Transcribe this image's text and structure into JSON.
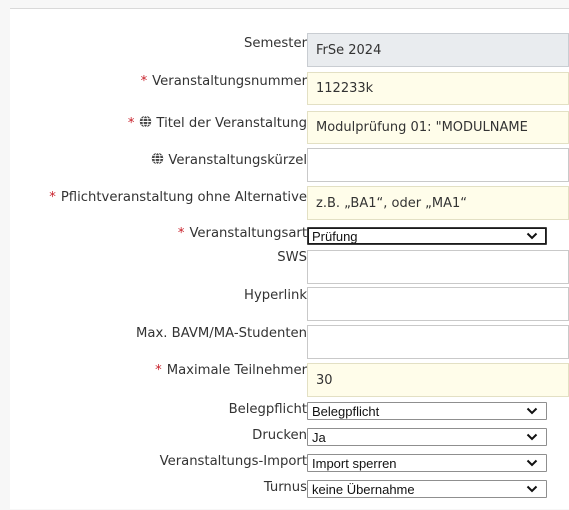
{
  "form": {
    "semester": {
      "label": "Semester",
      "value": "FrSe 2024"
    },
    "veranstaltungsnummer": {
      "required": "*",
      "label": "Veranstaltungsnummer",
      "value": "112233k"
    },
    "titel": {
      "required": "*",
      "label": "Titel der Veranstaltung",
      "value": "Modulprüfung 01: \"MODULNAME"
    },
    "kuerzel": {
      "label": "Veranstaltungskürzel",
      "value": ""
    },
    "pflicht": {
      "required": "*",
      "label": "Pflichtveranstaltung ohne Alternative",
      "placeholder": "z.B. „BA1“, oder „MA1“"
    },
    "art": {
      "required": "*",
      "label": "Veranstaltungsart",
      "value": "Prüfung"
    },
    "sws": {
      "label": "SWS",
      "value": ""
    },
    "hyperlink": {
      "label": "Hyperlink",
      "value": ""
    },
    "max_ba": {
      "label": "Max. BAVM/MA-Studenten",
      "value": ""
    },
    "max_teil": {
      "required": "*",
      "label": "Maximale Teilnehmer",
      "value": "30"
    },
    "belegpflicht": {
      "label": "Belegpflicht",
      "value": "Belegpflicht"
    },
    "drucken": {
      "label": "Drucken",
      "value": "Ja"
    },
    "import": {
      "label": "Veranstaltungs-Import",
      "value": "Import sperren"
    },
    "turnus": {
      "label": "Turnus",
      "value": "keine Übernahme"
    }
  },
  "icons": {
    "globe": "globe-icon",
    "chevron": "chevron-down-icon"
  },
  "colors": {
    "required": "#c8202a",
    "readonly_bg": "#e9ecef",
    "required_bg": "#fffdea"
  }
}
